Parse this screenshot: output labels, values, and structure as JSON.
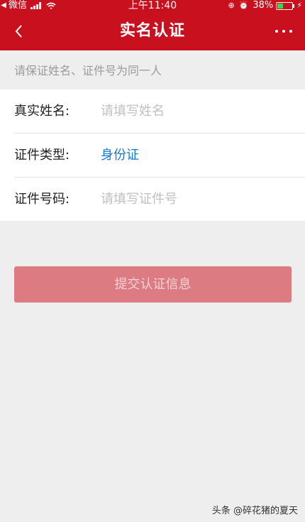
{
  "status_bar": {
    "carrier": "微信",
    "time": "上午11:40",
    "battery_text": "38%",
    "battery_level": 0.38
  },
  "nav": {
    "title": "实名认证"
  },
  "hint": "请保证姓名、证件号为同一人",
  "form": {
    "name": {
      "label": "真实姓名:",
      "placeholder": "请填写姓名",
      "value": ""
    },
    "id_type": {
      "label": "证件类型:",
      "value": "身份证"
    },
    "id_number": {
      "label": "证件号码:",
      "placeholder": "请填写证件号",
      "value": ""
    }
  },
  "submit_label": "提交认证信息",
  "watermark": "头条 @碎花猪的夏天",
  "colors": {
    "brand_red": "#c9101f",
    "link_blue": "#1677d2",
    "button_disabled": "#dd7b83",
    "battery_green": "#43d34a"
  }
}
